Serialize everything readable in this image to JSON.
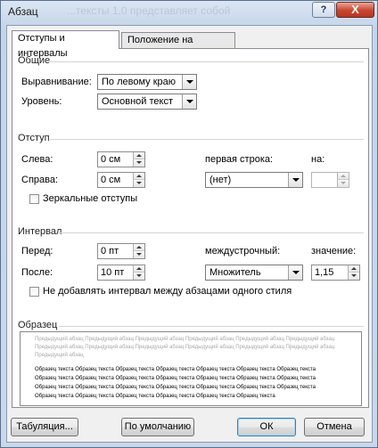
{
  "window": {
    "title": "Абзац",
    "background_ghost": "...тексты 1.0 представляет собой",
    "help_glyph": "?",
    "close_glyph": "X"
  },
  "tabs": [
    {
      "label": "Отступы и интервалы",
      "active": true
    },
    {
      "label": "Положение на странице",
      "active": false
    }
  ],
  "general": {
    "title": "Общие",
    "alignment_label": "Выравнивание:",
    "alignment_value": "По левому краю",
    "level_label": "Уровень:",
    "level_value": "Основной текст"
  },
  "indent": {
    "title": "Отступ",
    "left_label": "Слева:",
    "left_value": "0 см",
    "right_label": "Справа:",
    "right_value": "0 см",
    "first_line_label": "первая строка:",
    "first_line_value": "(нет)",
    "by_label": "на:",
    "by_value": "",
    "mirror_label": "Зеркальные отступы",
    "mirror_checked": false
  },
  "spacing": {
    "title": "Интервал",
    "before_label": "Перед:",
    "before_value": "0 пт",
    "after_label": "После:",
    "after_value": "10 пт",
    "line_label": "междустрочный:",
    "line_value": "Множитель",
    "at_label": "значение:",
    "at_value": "1,15",
    "no_space_label": "Не добавлять интервал между абзацами одного стиля",
    "no_space_checked": false
  },
  "preview": {
    "title": "Образец",
    "previous_lines": [
      "Предыдущий абзац Предыдущий абзац Предыдущий абзац Предыдущий абзац Предыдущий абзац Предыдущий абзац",
      "Предыдущий абзац Предыдущий абзац Предыдущий абзац Предыдущий абзац Предыдущий абзац Предыдущий абзац",
      "Предыдущий абзац"
    ],
    "sample_lines": [
      "Образец текста Образец текста Образец текста Образец текста Образец текста Образец текста Образец текста",
      "Образец текста Образец текста Образец текста Образец текста Образец текста Образец текста Образец текста",
      "Образец текста Образец текста Образец текста Образец текста Образец текста Образец текста Образец текста",
      "Образец текста Образец текста Образец текста Образец текста Образец текста Образец текста"
    ]
  },
  "buttons": {
    "tabs": "Табуляция...",
    "default": "По умолчанию",
    "ok": "ОК",
    "cancel": "Отмена"
  }
}
